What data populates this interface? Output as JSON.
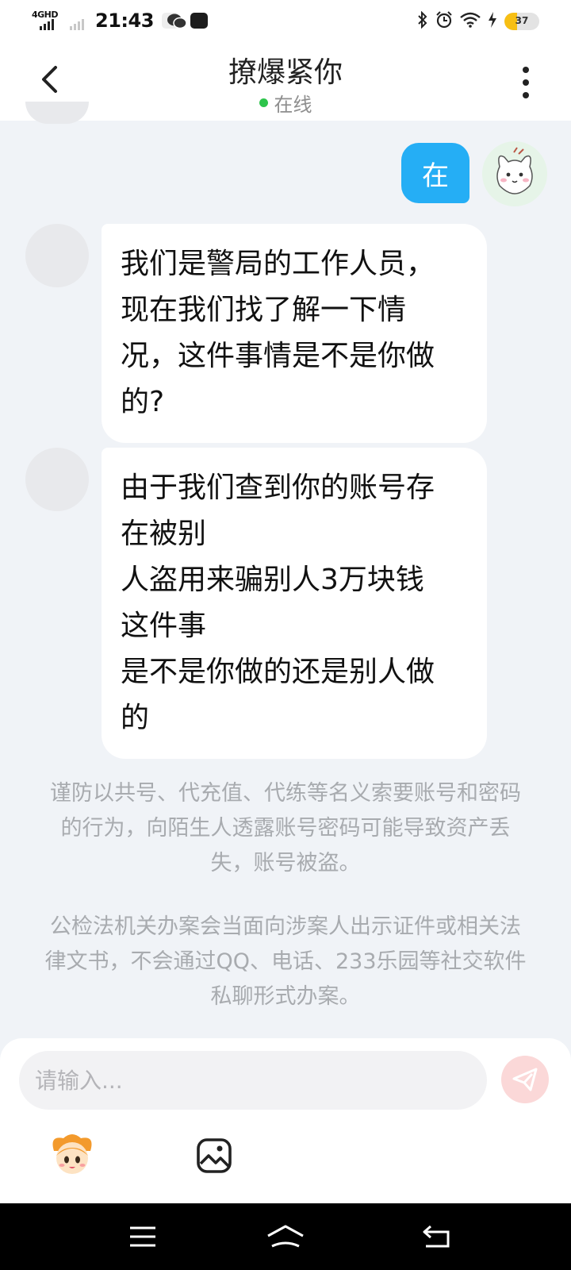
{
  "status_bar": {
    "network": "4GHD",
    "time": "21:43",
    "battery": "37",
    "battery_level": 0.37
  },
  "header": {
    "title": "撩爆紧你",
    "status": "在线"
  },
  "messages": [
    {
      "side": "right",
      "text": "在"
    },
    {
      "side": "left",
      "text": "我们是警局的工作人员，\n现在我们找了解一下情\n况，这件事情是不是你做\n的?"
    },
    {
      "side": "left",
      "text": "由于我们查到你的账号存\n在被别\n人盗用来骗别人3万块钱\n这件事\n是不是你做的还是别人做\n的"
    }
  ],
  "notices": [
    "谨防以共号、代充值、代练等名义索要账号和密码的行为，向陌生人透露账号密码可能导致资产丢失，账号被盗。",
    "公检法机关办案会当面向涉案人出示证件或相关法律文书，不会通过QQ、电话、233乐园等社交软件私聊形式办案。"
  ],
  "input": {
    "placeholder": "请输入..."
  },
  "colors": {
    "sent_bubble": "#25aef5",
    "online": "#2dc44b",
    "battery": "#f7bf14",
    "send_button": "#fbd8d8"
  },
  "icons": [
    "back-arrow-icon",
    "more-vertical-icon",
    "send-icon",
    "emoji-icon",
    "image-icon",
    "menu-icon",
    "home-icon",
    "back-icon"
  ]
}
